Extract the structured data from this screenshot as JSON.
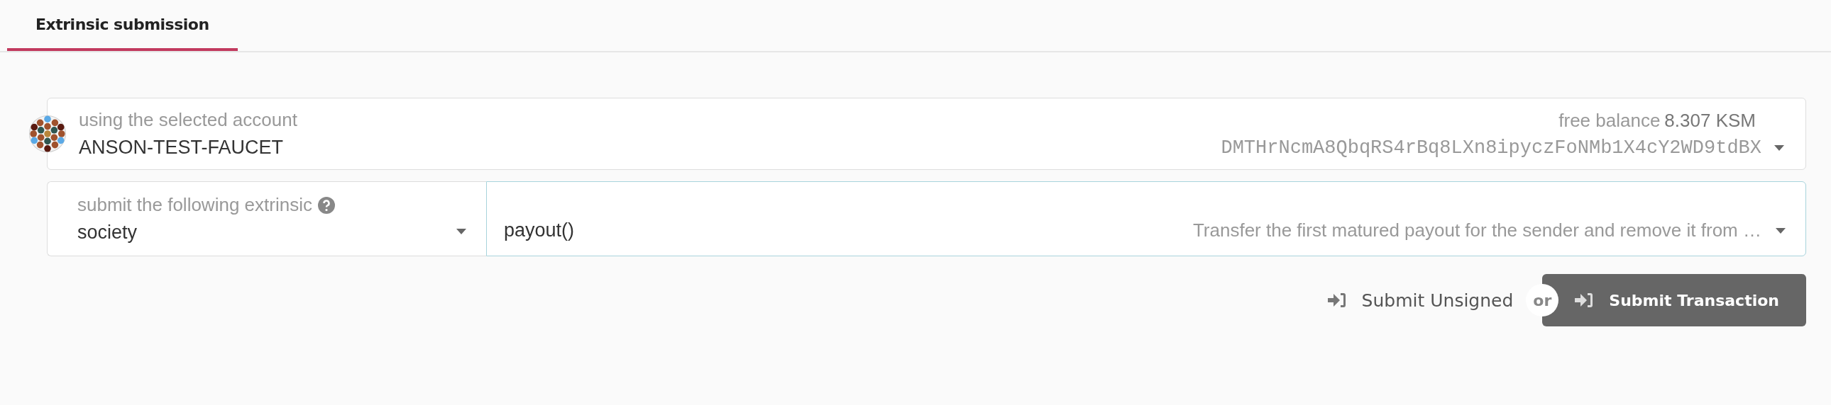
{
  "tabs": [
    {
      "label": "Extrinsic submission",
      "selected": true
    }
  ],
  "account": {
    "label": "using the selected account",
    "name": "ANSON-TEST-FAUCET",
    "balance_label": "free balance",
    "balance": "8.307 KSM",
    "address": "DMTHrNcmA8QbqRS4rBq8LXn8ipyczFoNMb1X4cY2WD9tdBX"
  },
  "extrinsic": {
    "label": "submit the following extrinsic",
    "section": "society",
    "method": "payout()",
    "description": "Transfer the first matured payout for the sender and remove it from …"
  },
  "separator": "or",
  "buttons": [
    {
      "label": "Submit Unsigned",
      "kind": "secondary"
    },
    {
      "label": "Submit Transaction",
      "kind": "primary"
    }
  ]
}
